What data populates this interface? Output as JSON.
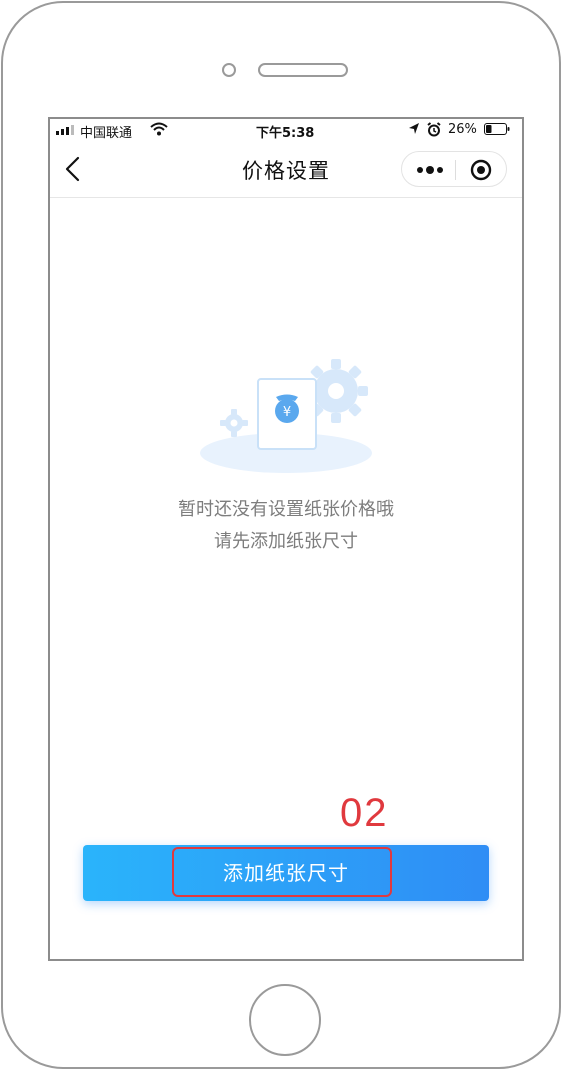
{
  "status_bar": {
    "carrier": "中国联通",
    "time": "下午5:38",
    "battery_pct": "26%"
  },
  "nav": {
    "title": "价格设置"
  },
  "empty_state": {
    "line1": "暂时还没有设置纸张价格哦",
    "line2": "请先添加纸张尺寸",
    "illustration_symbol": "¥"
  },
  "action": {
    "button_label": "添加纸张尺寸"
  },
  "annotation": {
    "number": "02",
    "color": "#e0393e"
  },
  "colors": {
    "button_gradient_start": "#2ab4fb",
    "button_gradient_end": "#2f8df5",
    "illustration_blue": "#5aa8ee"
  },
  "icons": [
    "back-arrow-icon",
    "more-dots-icon",
    "target-icon",
    "wifi-icon",
    "location-icon",
    "alarm-icon",
    "battery-icon"
  ]
}
